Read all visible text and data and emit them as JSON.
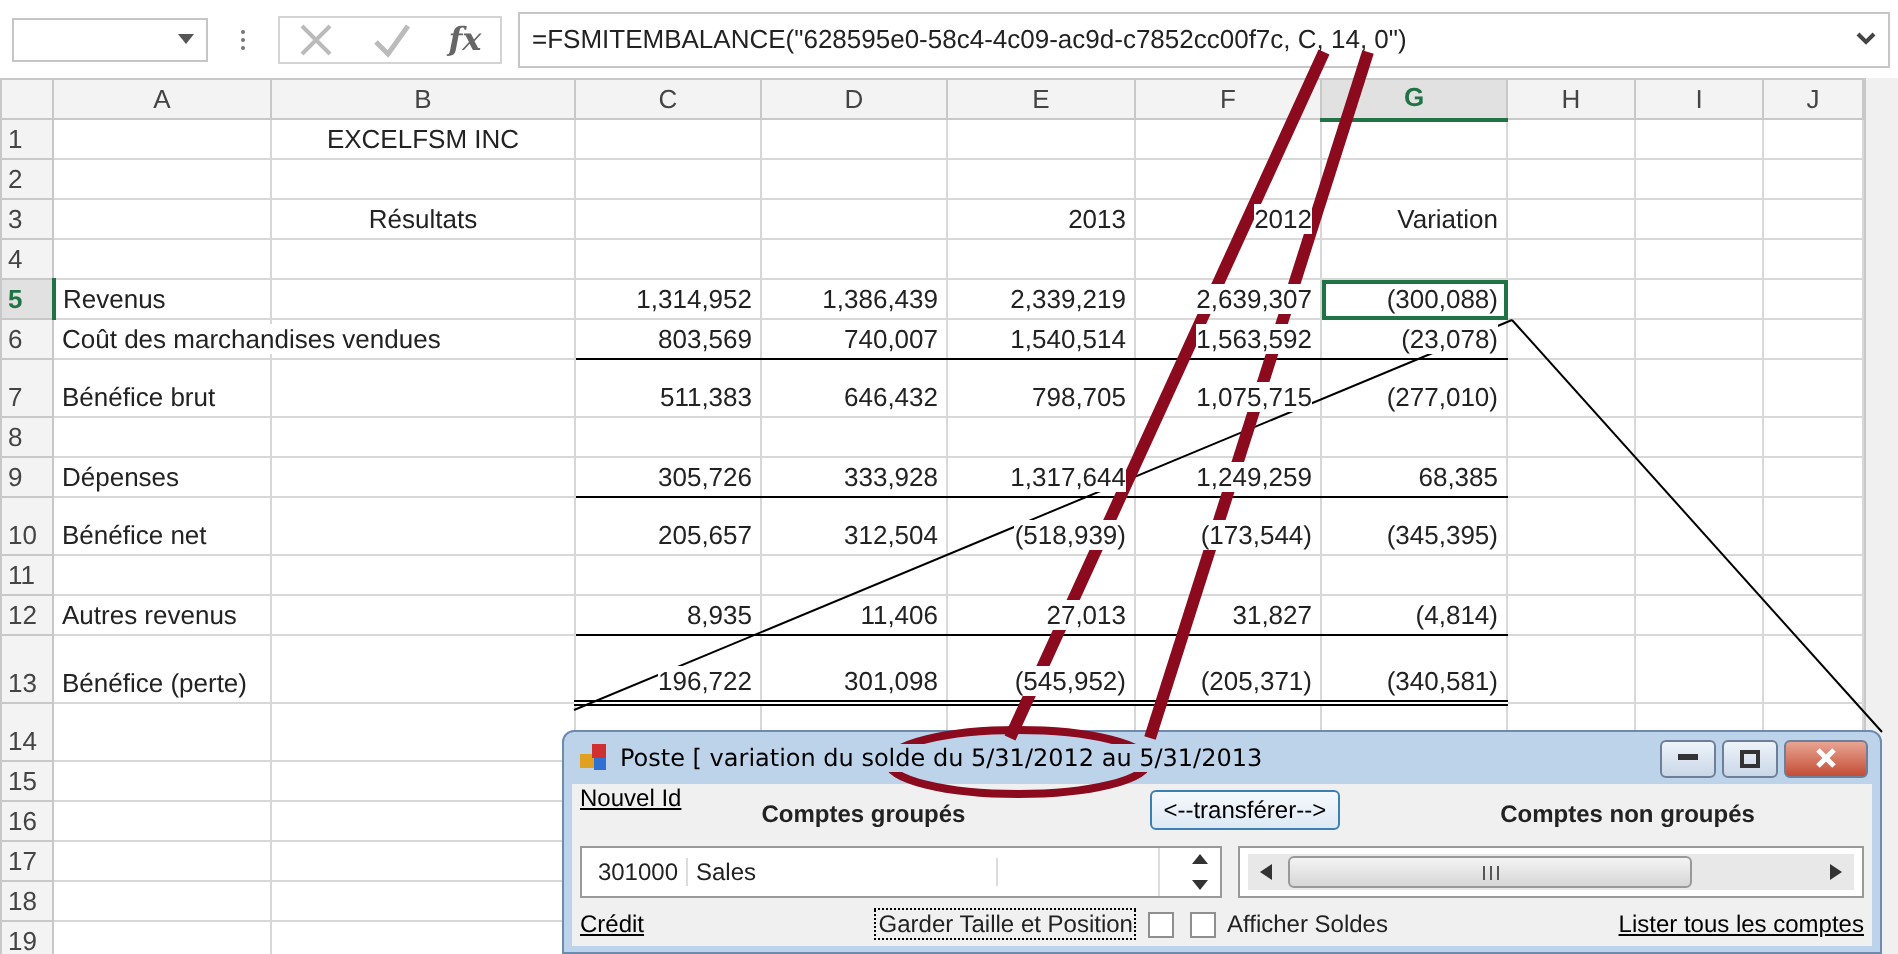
{
  "formula_bar": {
    "cancel_glyph": "fx",
    "formula": "=FSMITEMBALANCE(\"628595e0-58c4-4c09-ac9d-c7852cc00f7c, C, 14, 0\")"
  },
  "sheet": {
    "columns": [
      {
        "label": "A",
        "selected": false
      },
      {
        "label": "B",
        "selected": false
      },
      {
        "label": "C",
        "selected": false
      },
      {
        "label": "D",
        "selected": false
      },
      {
        "label": "E",
        "selected": false
      },
      {
        "label": "F",
        "selected": false
      },
      {
        "label": "G",
        "selected": true
      },
      {
        "label": "H",
        "selected": false
      },
      {
        "label": "I",
        "selected": false
      },
      {
        "label": "J",
        "selected": false
      }
    ],
    "rows": [
      {
        "number": "1",
        "selected": false,
        "underlined": false,
        "double_underline": false,
        "cells": [
          null,
          "EXCELFSM INC",
          null,
          null,
          null,
          null,
          null,
          null,
          null,
          null
        ]
      },
      {
        "number": "2",
        "selected": false,
        "underlined": false,
        "double_underline": false,
        "cells": [
          null,
          null,
          null,
          null,
          null,
          null,
          null,
          null,
          null,
          null
        ]
      },
      {
        "number": "3",
        "selected": false,
        "underlined": false,
        "double_underline": false,
        "cells": [
          null,
          "Résultats",
          null,
          null,
          "2013",
          "2012",
          "Variation",
          null,
          null,
          null
        ]
      },
      {
        "number": "4",
        "selected": false,
        "underlined": false,
        "double_underline": false,
        "cells": [
          null,
          null,
          null,
          null,
          null,
          null,
          null,
          null,
          null,
          null
        ]
      },
      {
        "number": "5",
        "selected": true,
        "underlined": false,
        "double_underline": false,
        "cells": [
          "Revenus",
          null,
          "1,314,952",
          "1,386,439",
          "2,339,219",
          "2,639,307",
          "(300,088)",
          null,
          null,
          null
        ]
      },
      {
        "number": "6",
        "selected": false,
        "underlined": true,
        "double_underline": false,
        "cells": [
          "Coût des marchandises vendues",
          null,
          "803,569",
          "740,007",
          "1,540,514",
          "1,563,592",
          "(23,078)",
          null,
          null,
          null
        ]
      },
      {
        "number": "7",
        "selected": false,
        "underlined": false,
        "double_underline": false,
        "cells": [
          "Bénéfice brut",
          null,
          "511,383",
          "646,432",
          "798,705",
          "1,075,715",
          "(277,010)",
          null,
          null,
          null
        ]
      },
      {
        "number": "8",
        "selected": false,
        "underlined": false,
        "double_underline": false,
        "cells": [
          null,
          null,
          null,
          null,
          null,
          null,
          null,
          null,
          null,
          null
        ]
      },
      {
        "number": "9",
        "selected": false,
        "underlined": true,
        "double_underline": false,
        "cells": [
          "Dépenses",
          null,
          "305,726",
          "333,928",
          "1,317,644",
          "1,249,259",
          "68,385",
          null,
          null,
          null
        ]
      },
      {
        "number": "10",
        "selected": false,
        "underlined": false,
        "double_underline": false,
        "cells": [
          "Bénéfice net",
          null,
          "205,657",
          "312,504",
          "(518,939)",
          "(173,544)",
          "(345,395)",
          null,
          null,
          null
        ]
      },
      {
        "number": "11",
        "selected": false,
        "underlined": false,
        "double_underline": false,
        "cells": [
          null,
          null,
          null,
          null,
          null,
          null,
          null,
          null,
          null,
          null
        ]
      },
      {
        "number": "12",
        "selected": false,
        "underlined": true,
        "double_underline": false,
        "cells": [
          "Autres revenus",
          null,
          "8,935",
          "11,406",
          "27,013",
          "31,827",
          "(4,814)",
          null,
          null,
          null
        ]
      },
      {
        "number": "13",
        "selected": false,
        "underlined": true,
        "double_underline": true,
        "cells": [
          "Bénéfice (perte)",
          null,
          "196,722",
          "301,098",
          "(545,952)",
          "(205,371)",
          "(340,581)",
          null,
          null,
          null
        ]
      },
      {
        "number": "14",
        "selected": false,
        "underlined": false,
        "double_underline": false,
        "cells": [
          null,
          null,
          null,
          null,
          null,
          null,
          null,
          null,
          null,
          null
        ]
      },
      {
        "number": "15",
        "selected": false,
        "underlined": false,
        "double_underline": false,
        "cells": [
          null,
          null,
          null,
          null,
          null,
          null,
          null,
          null,
          null,
          null
        ]
      },
      {
        "number": "16",
        "selected": false,
        "underlined": false,
        "double_underline": false,
        "cells": [
          null,
          null,
          null,
          null,
          null,
          null,
          null,
          null,
          null,
          null
        ]
      },
      {
        "number": "17",
        "selected": false,
        "underlined": false,
        "double_underline": false,
        "cells": [
          null,
          null,
          null,
          null,
          null,
          null,
          null,
          null,
          null,
          null
        ]
      },
      {
        "number": "18",
        "selected": false,
        "underlined": false,
        "double_underline": false,
        "cells": [
          null,
          null,
          null,
          null,
          null,
          null,
          null,
          null,
          null,
          null
        ]
      },
      {
        "number": "19",
        "selected": false,
        "underlined": false,
        "double_underline": false,
        "cells": [
          null,
          null,
          null,
          null,
          null,
          null,
          null,
          null,
          null,
          null
        ]
      }
    ]
  },
  "dialog": {
    "title": "Poste  [ variation du solde du 5/31/2012 au 5/31/2013",
    "new_id_link": "Nouvel Id",
    "left_heading": "Comptes groupés",
    "transfer_button": "<--transférer-->",
    "right_heading": "Comptes non groupés",
    "grouped_rows": [
      {
        "account": "301000",
        "name": "Sales"
      }
    ],
    "credit_link": "Crédit",
    "keep_size": {
      "label": "Garder Taille et Position",
      "checked": false
    },
    "show_balances": {
      "label": "Afficher Soldes",
      "checked": false
    },
    "list_all_link": "Lister tous les comptes"
  }
}
